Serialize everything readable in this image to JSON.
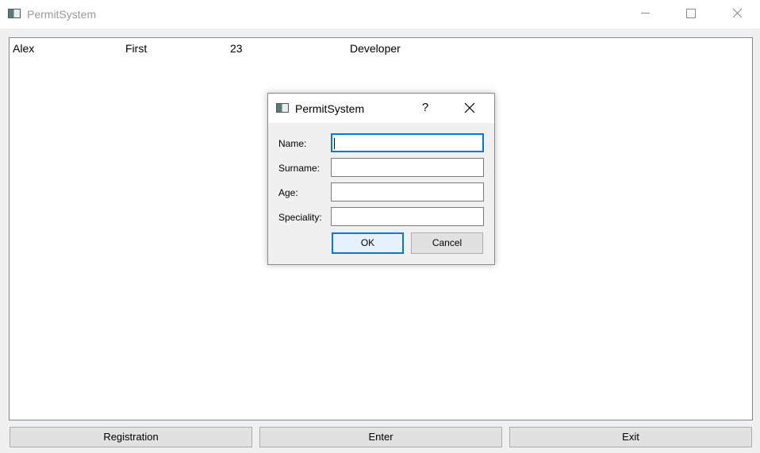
{
  "window": {
    "title": "PermitSystem",
    "icon": "app-window-icon",
    "controls": {
      "minimize": "minimize-icon",
      "maximize": "maximize-icon",
      "close": "close-icon"
    }
  },
  "list": {
    "rows": [
      [
        "Alex",
        "First",
        "23",
        "Developer"
      ]
    ]
  },
  "buttons": {
    "registration": "Registration",
    "enter": "Enter",
    "exit": "Exit"
  },
  "dialog": {
    "title": "PermitSystem",
    "help": "?",
    "fields": {
      "name": {
        "label": "Name:",
        "value": ""
      },
      "surname": {
        "label": "Surname:",
        "value": ""
      },
      "age": {
        "label": "Age:",
        "value": ""
      },
      "speciality": {
        "label": "Speciality:",
        "value": ""
      }
    },
    "ok_label": "OK",
    "cancel_label": "Cancel"
  },
  "colors": {
    "accent": "#0078d7",
    "title_inactive": "#9a9a9a"
  }
}
